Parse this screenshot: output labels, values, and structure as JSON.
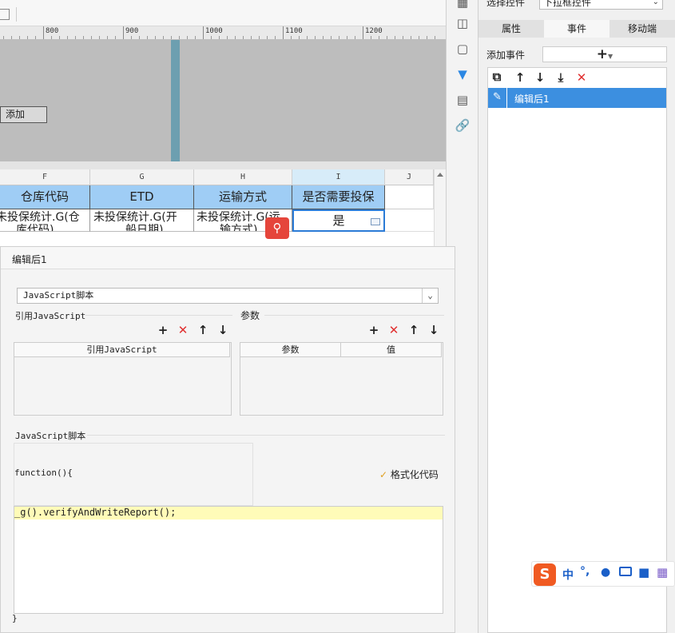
{
  "ruler": {
    "ticks": [
      "800",
      "900",
      "1000",
      "1100",
      "1200"
    ]
  },
  "canvas": {
    "add_button": "添加"
  },
  "sheet": {
    "columns": [
      "F",
      "G",
      "H",
      "I",
      "J"
    ],
    "headers": [
      "仓库代码",
      "ETD",
      "运输方式",
      "是否需要投保"
    ],
    "row1": [
      "未投保统计.G(仓",
      "未投保统计.G(开",
      "未投保统计.G(运",
      "是"
    ],
    "row1_wrap": [
      "库代码)",
      "船日期)",
      "输方式)"
    ]
  },
  "right_panel": {
    "select_label": "选择控件",
    "select_value": "下拉框控件",
    "tabs": [
      "属性",
      "事件",
      "移动端"
    ],
    "add_event_label": "添加事件",
    "add_event_button": "+",
    "events": [
      "编辑后1"
    ]
  },
  "dialog": {
    "title": "编辑后1",
    "script_type": "JavaScript脚本",
    "ref_js_label": "引用JavaScript",
    "params_label": "参数",
    "ref_js_col": "引用JavaScript",
    "param_col": "参数",
    "value_col": "值",
    "script_section": "JavaScript脚本",
    "function_header": "function(){",
    "format_button": "格式化代码",
    "code_line": "_g().verifyAndWriteReport();",
    "closing_brace": "}"
  },
  "ime": {
    "mode": "中"
  }
}
